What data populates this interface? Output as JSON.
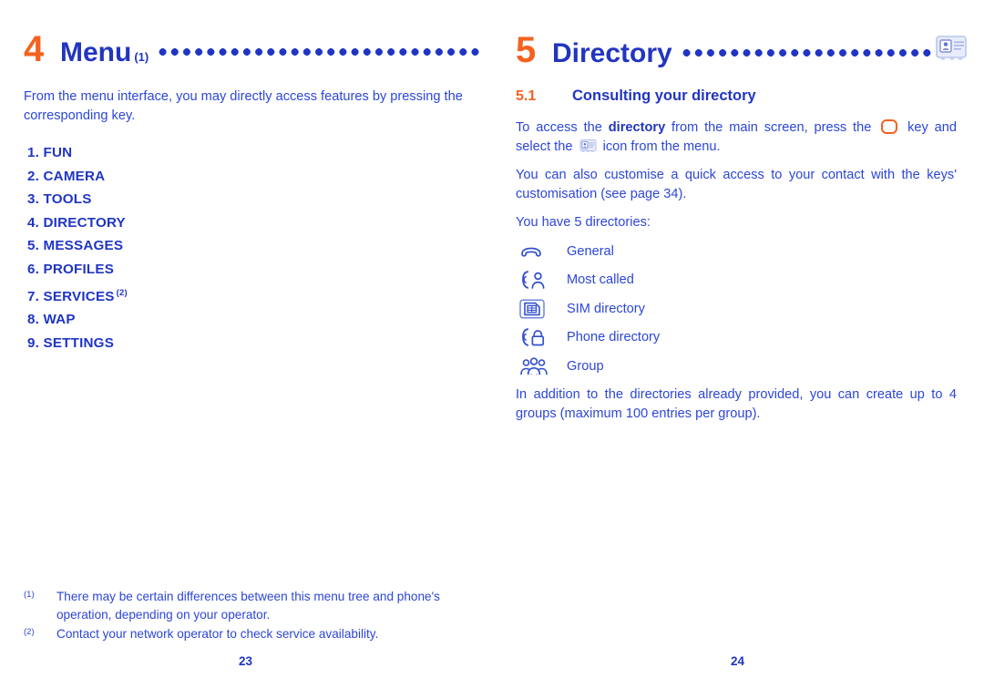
{
  "colors": {
    "orange": "#f4621f",
    "blue": "#2235c0",
    "body_blue": "#2c46d8",
    "icon_light": "#c8d2f2"
  },
  "left_page": {
    "chapter": {
      "number": "4",
      "title": "Menu",
      "superscript": "(1)",
      "leader": "............................."
    },
    "intro": "From the menu interface, you may directly access features by pressing the corresponding key.",
    "menu_items": [
      {
        "label": "1. FUN",
        "superscript": ""
      },
      {
        "label": "2. CAMERA",
        "superscript": ""
      },
      {
        "label": "3. TOOLS",
        "superscript": ""
      },
      {
        "label": "4. DIRECTORY",
        "superscript": ""
      },
      {
        "label": "5. MESSAGES",
        "superscript": ""
      },
      {
        "label": "6. PROFILES",
        "superscript": ""
      },
      {
        "label": "7. SERVICES",
        "superscript": "(2)"
      },
      {
        "label": "8. WAP",
        "superscript": ""
      },
      {
        "label": "9. SETTINGS",
        "superscript": ""
      }
    ],
    "footnotes": [
      {
        "mark": "(1)",
        "text": "There may be certain differences between this menu tree and phone's operation, depending on your operator."
      },
      {
        "mark": "(2)",
        "text": "Contact your network operator to check service availability."
      }
    ],
    "page_number": "23"
  },
  "right_page": {
    "chapter": {
      "number": "5",
      "title": "Directory",
      "superscript": "",
      "leader": "........................",
      "icon": "address-book-icon"
    },
    "section": {
      "number": "5.1",
      "title": "Consulting your directory"
    },
    "access_text": {
      "part1": "To access the ",
      "bold1": "directory",
      "part2": " from the main screen, press the ",
      "key_icon": "ok-key-icon",
      "part3": " key and select the ",
      "book_icon": "address-book-icon",
      "part4": " icon from the menu."
    },
    "customise_text": "You can also customise a quick access to your contact with the keys' customisation (see page 34).",
    "list_intro": "You have 5 directories:",
    "directories": [
      {
        "icon": "handset-icon",
        "label": "General"
      },
      {
        "icon": "handset-person-icon",
        "label": "Most called"
      },
      {
        "icon": "sim-card-icon",
        "label": "SIM directory"
      },
      {
        "icon": "handset-lock-icon",
        "label": "Phone directory"
      },
      {
        "icon": "group-people-icon",
        "label": "Group"
      }
    ],
    "closing_text": "In addition to the directories already provided, you can create up to 4 groups (maximum 100 entries per group).",
    "page_number": "24"
  }
}
